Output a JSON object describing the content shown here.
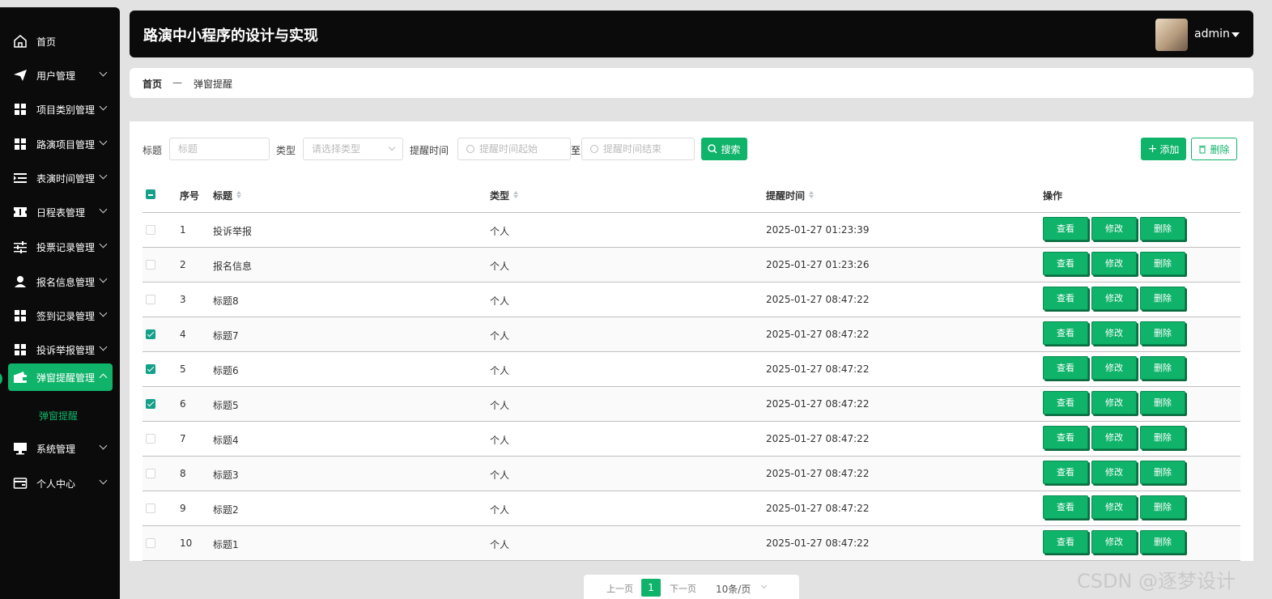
{
  "sidebar": {
    "items": [
      {
        "label": "首页",
        "icon": "home-icon"
      },
      {
        "label": "用户管理",
        "icon": "send-icon"
      },
      {
        "label": "项目类别管理",
        "icon": "grid-icon"
      },
      {
        "label": "路演项目管理",
        "icon": "grid-icon"
      },
      {
        "label": "表演时间管理",
        "icon": "list-indent-icon"
      },
      {
        "label": "日程表管理",
        "icon": "ticket-icon"
      },
      {
        "label": "投票记录管理",
        "icon": "sliders-icon"
      },
      {
        "label": "报名信息管理",
        "icon": "person-icon"
      },
      {
        "label": "签到记录管理",
        "icon": "grid-icon"
      },
      {
        "label": "投诉举报管理",
        "icon": "grid-icon"
      },
      {
        "label": "弹窗提醒管理",
        "icon": "wallet-icon"
      },
      {
        "label": "系统管理",
        "icon": "monitor-icon"
      },
      {
        "label": "个人中心",
        "icon": "card-icon"
      }
    ],
    "submenu": {
      "label": "弹窗提醒"
    }
  },
  "header": {
    "title": "路演中小程序的设计与实现",
    "user": "admin"
  },
  "breadcrumb": {
    "home": "首页",
    "separator": "—",
    "current": "弹窗提醒"
  },
  "filters": {
    "title_label": "标题",
    "title_placeholder": "标题",
    "type_label": "类型",
    "type_placeholder": "请选择类型",
    "time_label": "提醒时间",
    "time_start_placeholder": "提醒时间起始",
    "to_label": "至",
    "time_end_placeholder": "提醒时间结束",
    "search_button": "搜索",
    "add_button": "添加",
    "delete_button": "删除"
  },
  "table": {
    "headers": {
      "index": "序号",
      "title": "标题",
      "type": "类型",
      "time": "提醒时间",
      "actions": "操作"
    },
    "action_labels": {
      "view": "查看",
      "edit": "修改",
      "delete": "删除"
    },
    "rows": [
      {
        "index": "1",
        "title": "投诉举报",
        "type": "个人",
        "time": "2025-01-27 01:23:39",
        "checked": false
      },
      {
        "index": "2",
        "title": "报名信息",
        "type": "个人",
        "time": "2025-01-27 01:23:26",
        "checked": false
      },
      {
        "index": "3",
        "title": "标题8",
        "type": "个人",
        "time": "2025-01-27 08:47:22",
        "checked": false
      },
      {
        "index": "4",
        "title": "标题7",
        "type": "个人",
        "time": "2025-01-27 08:47:22",
        "checked": true
      },
      {
        "index": "5",
        "title": "标题6",
        "type": "个人",
        "time": "2025-01-27 08:47:22",
        "checked": true
      },
      {
        "index": "6",
        "title": "标题5",
        "type": "个人",
        "time": "2025-01-27 08:47:22",
        "checked": true
      },
      {
        "index": "7",
        "title": "标题4",
        "type": "个人",
        "time": "2025-01-27 08:47:22",
        "checked": false
      },
      {
        "index": "8",
        "title": "标题3",
        "type": "个人",
        "time": "2025-01-27 08:47:22",
        "checked": false
      },
      {
        "index": "9",
        "title": "标题2",
        "type": "个人",
        "time": "2025-01-27 08:47:22",
        "checked": false
      },
      {
        "index": "10",
        "title": "标题1",
        "type": "个人",
        "time": "2025-01-27 08:47:22",
        "checked": false
      }
    ]
  },
  "pagination": {
    "prev": "上一页",
    "current": "1",
    "next": "下一页",
    "page_size": "10条/页"
  },
  "watermark": "CSDN @逐梦设计",
  "colors": {
    "accent": "#0fb36a",
    "sidebar_bg": "#0b0b0b",
    "page_bg": "#e2e2e2"
  }
}
